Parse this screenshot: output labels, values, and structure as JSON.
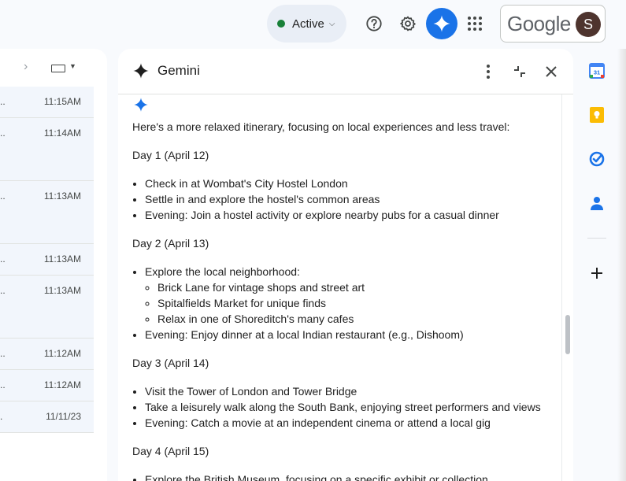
{
  "topbar": {
    "status_label": "Active",
    "status_color": "#188038",
    "help_icon": "help-icon",
    "settings_icon": "gear-icon",
    "gemini_icon": "gemini-spark-icon",
    "apps_icon": "apps-grid-icon",
    "brand": "Google",
    "avatar_initial": "S"
  },
  "mail_list": {
    "rows": [
      {
        "snippet": "..",
        "time": "11:15AM"
      },
      {
        "snippet": "..",
        "time": "11:14AM"
      },
      {
        "snippet": "..",
        "time": "11:13AM"
      },
      {
        "snippet": "..",
        "time": "11:13AM"
      },
      {
        "snippet": "..",
        "time": "11:13AM"
      },
      {
        "snippet": "..",
        "time": "11:12AM"
      },
      {
        "snippet": "..",
        "time": "11:12AM"
      },
      {
        "snippet": ".",
        "time": "11/11/23"
      }
    ]
  },
  "gemini": {
    "title": "Gemini",
    "accent": "#1a73e8",
    "intro": "Here's a more relaxed itinerary, focusing on local experiences and less travel:",
    "days": [
      {
        "heading": "Day 1 (April 12)",
        "items": [
          {
            "text": "Check in at Wombat's City Hostel London"
          },
          {
            "text": "Settle in and explore the hostel's common areas"
          },
          {
            "text": "Evening: Join a hostel activity or explore nearby pubs for a casual dinner"
          }
        ]
      },
      {
        "heading": "Day 2 (April 13)",
        "items": [
          {
            "text": "Explore the local neighborhood:",
            "sub": [
              "Brick Lane for vintage shops and street art",
              "Spitalfields Market for unique finds",
              "Relax in one of Shoreditch's many cafes"
            ]
          },
          {
            "text": "Evening: Enjoy dinner at a local Indian restaurant (e.g., Dishoom)"
          }
        ]
      },
      {
        "heading": "Day 3 (April 14)",
        "items": [
          {
            "text": "Visit the Tower of London and Tower Bridge"
          },
          {
            "text": "Take a leisurely walk along the South Bank, enjoying street performers and views"
          },
          {
            "text": "Evening: Catch a movie at an independent cinema or attend a local gig"
          }
        ]
      },
      {
        "heading": "Day 4 (April 15)",
        "items": [
          {
            "text": "Explore the British Museum, focusing on a specific exhibit or collection"
          }
        ]
      }
    ]
  },
  "side_panel": {
    "icons": [
      "calendar-icon",
      "keep-icon",
      "tasks-icon",
      "contacts-icon",
      "add-icon"
    ],
    "calendar_day": "31"
  }
}
